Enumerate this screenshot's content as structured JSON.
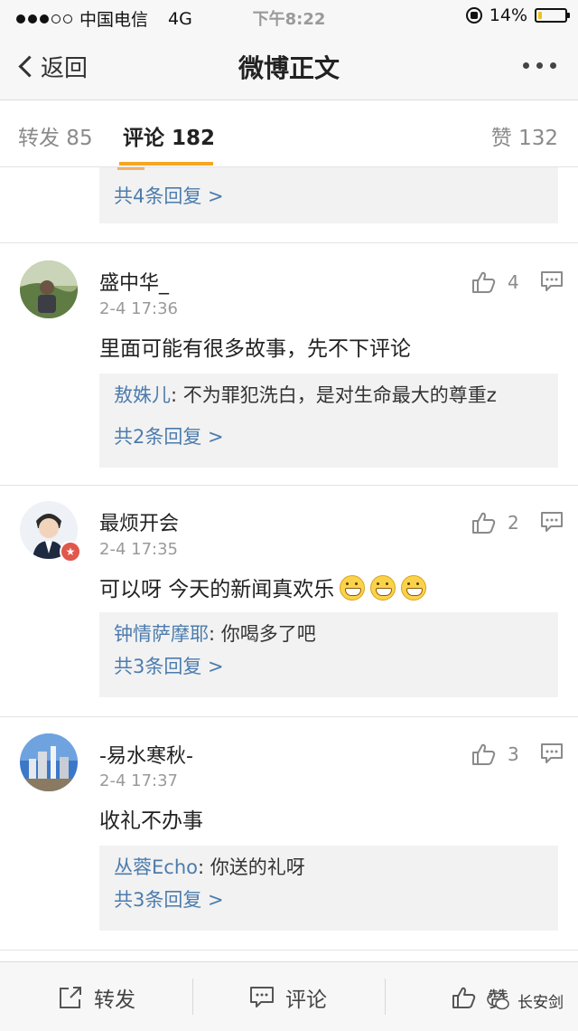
{
  "status_bar": {
    "carrier": "中国电信",
    "network": "4G",
    "time": "下午8:22",
    "battery": "14%",
    "battery_level": 0.14,
    "signal_dots": 5,
    "signal_filled": 3
  },
  "navbar": {
    "back_label": "返回",
    "title": "微博正文"
  },
  "tabs": {
    "repost": "转发 85",
    "comments": "评论 182",
    "likes": "赞 132"
  },
  "first_reply": {
    "count_text": "共4条回复 >"
  },
  "comments": [
    {
      "name": "盛中华_",
      "time": "2-4 17:36",
      "likes": "4",
      "text": "里面可能有很多故事，先不下评论",
      "reply_author": "敖姝儿",
      "reply_text": ": 不为罪犯洗白，是对生命最大的尊重z",
      "reply_count": "共2条回复 >"
    },
    {
      "name": "最烦开会",
      "time": "2-4 17:35",
      "likes": "2",
      "text": "可以呀 今天的新闻真欢乐",
      "reply_author": "钟情萨摩耶",
      "reply_text": ": 你喝多了吧",
      "reply_count": "共3条回复 >"
    },
    {
      "name": "-易水寒秋-",
      "time": "2-4 17:37",
      "likes": "3",
      "text": "收礼不办事",
      "reply_author": "丛蓉Echo",
      "reply_text": ": 你送的礼呀",
      "reply_count": "共3条回复 >"
    }
  ],
  "bottom_bar": {
    "repost": "转发",
    "comment": "评论",
    "like": "赞",
    "watermark": "长安剑"
  },
  "colors": {
    "accent": "#f5a623",
    "link": "#4c7cad",
    "reply_bg": "#f2f2f2"
  }
}
